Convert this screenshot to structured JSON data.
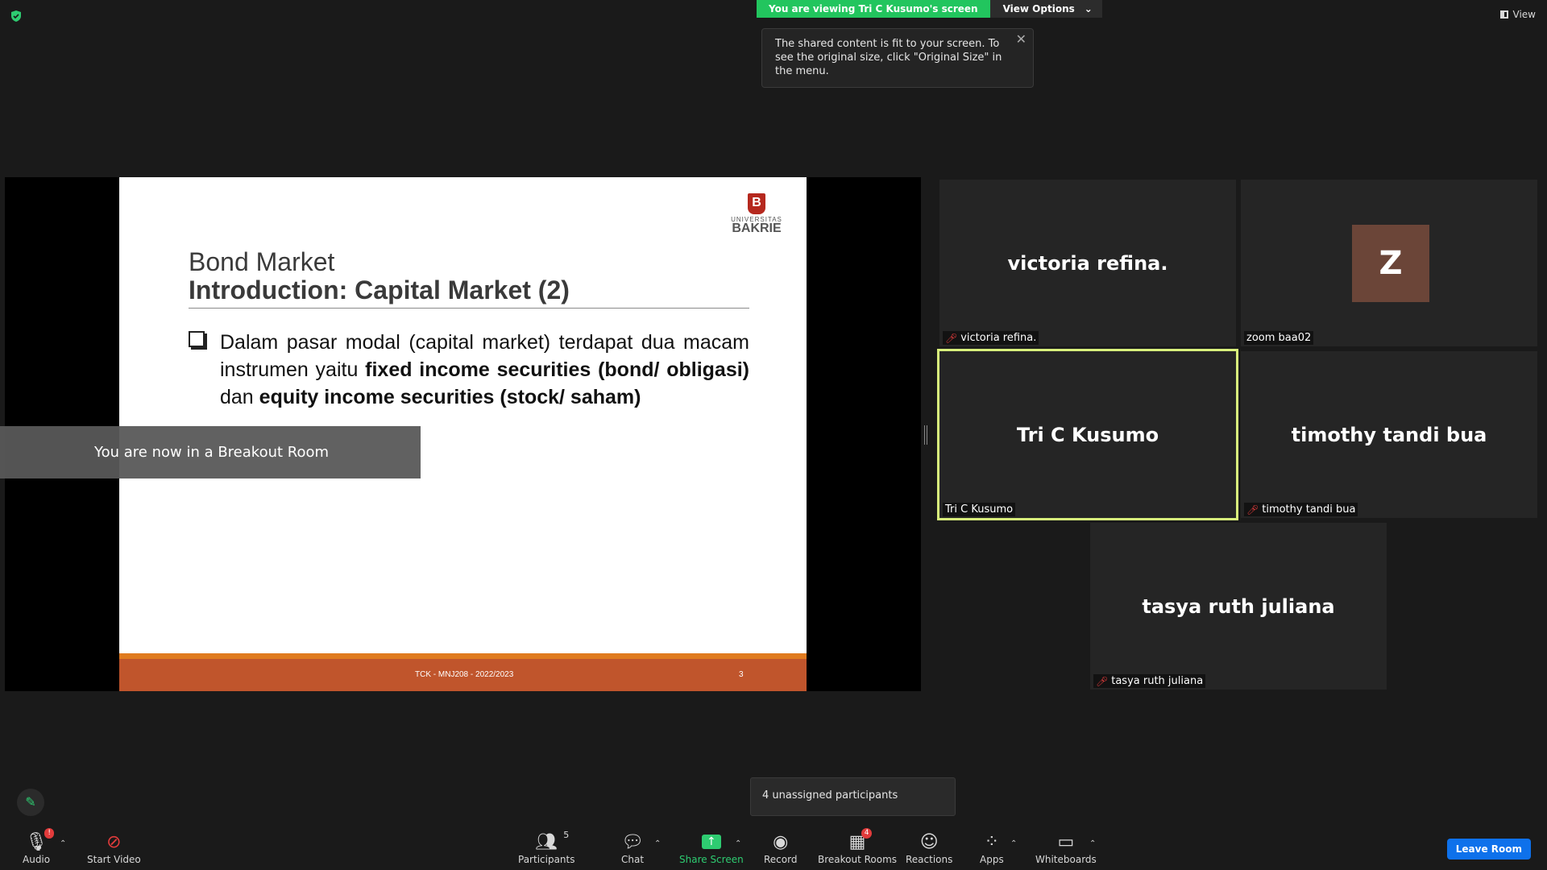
{
  "top": {
    "share_banner": "You are viewing Tri C Kusumo's screen",
    "view_options": "View Options",
    "view_label": "View"
  },
  "tooltip": {
    "text": "The shared content is fit to your screen. To see the original size, click \"Original Size\" in the menu."
  },
  "slide": {
    "logo_small": "UNIVERSITAS",
    "logo_big": "BAKRIE",
    "title": "Bond Market",
    "subtitle": "Introduction: Capital Market (2)",
    "text_part1": "Dalam pasar modal (capital market)  terdapat dua macam instrumen yaitu ",
    "text_bold1": "fixed income securities (bond/ obligasi)",
    "text_part2": " dan ",
    "text_bold2": "equity income securities (stock/ saham)",
    "footer_course": "TCK - MNJ208 - 2022/2023",
    "footer_page": "3",
    "colors": {
      "footer": "#c0552c",
      "footer_accent": "#e07b1f",
      "logo": "#b5281e"
    }
  },
  "breakout_toast": "You are now in a Breakout Room",
  "participants": [
    {
      "big_name": "victoria refina.",
      "label": "victoria refina.",
      "muted": true
    },
    {
      "avatar_letter": "Z",
      "label": "zoom baa02",
      "muted": false
    },
    {
      "big_name": "Tri C Kusumo",
      "label": "Tri C Kusumo",
      "muted": false,
      "active_speaker": true
    },
    {
      "big_name": "timothy tandi bua",
      "label": "timothy tandi bua",
      "muted": true
    },
    {
      "big_name": "tasya ruth juliana",
      "label": "tasya ruth juliana",
      "muted": true
    }
  ],
  "unassigned_popup": "4 unassigned participants",
  "toolbar": {
    "audio": "Audio",
    "audio_badge": "!",
    "start_video": "Start Video",
    "participants": "Participants",
    "participants_count": "5",
    "chat": "Chat",
    "share_screen": "Share Screen",
    "record": "Record",
    "breakout_rooms": "Breakout Rooms",
    "breakout_badge": "4",
    "reactions": "Reactions",
    "apps": "Apps",
    "whiteboards": "Whiteboards",
    "leave_room": "Leave Room"
  }
}
